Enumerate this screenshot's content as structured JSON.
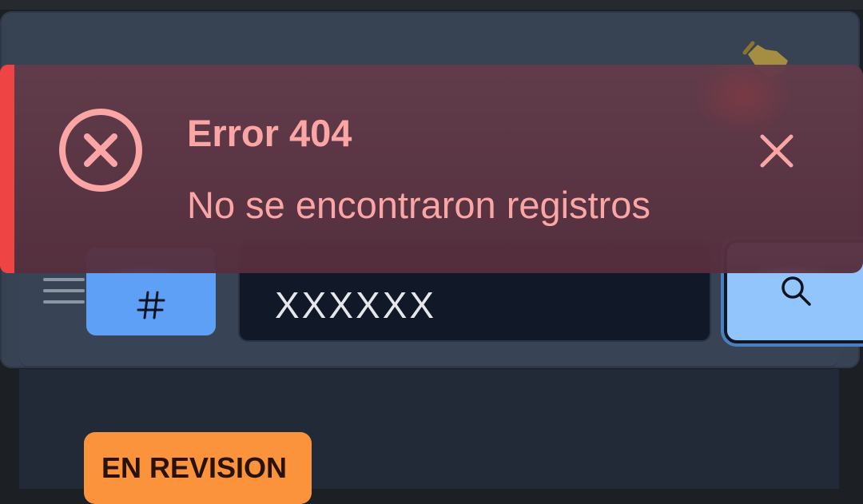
{
  "toast": {
    "title": "Error 404",
    "message": "No se encontraron registros",
    "icon": "x-circle-icon",
    "close_icon": "close-icon",
    "accent_color": "#ef4444",
    "text_color": "#fca5a5"
  },
  "toolbar": {
    "menu_icon": "hamburger-icon",
    "hash_icon": "hash-icon",
    "search_icon": "search-icon"
  },
  "search": {
    "value": "XXXXXX"
  },
  "record": {
    "status": "EN REVISION"
  }
}
